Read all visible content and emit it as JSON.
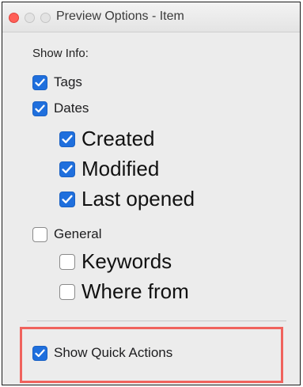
{
  "window": {
    "title": "Preview Options - Item"
  },
  "options": {
    "section_label": "Show Info:",
    "tags": {
      "label": "Tags",
      "checked": true
    },
    "dates": {
      "label": "Dates",
      "checked": true
    },
    "created": {
      "label": "Created",
      "checked": true
    },
    "modified": {
      "label": "Modified",
      "checked": true
    },
    "last_opened": {
      "label": "Last opened",
      "checked": true
    },
    "general": {
      "label": "General",
      "checked": false
    },
    "keywords": {
      "label": "Keywords",
      "checked": false
    },
    "where_from": {
      "label": "Where from",
      "checked": false
    },
    "show_quick_actions": {
      "label": "Show Quick Actions",
      "checked": true
    }
  },
  "colors": {
    "checkbox_accent": "#1f6fdd",
    "highlight_border": "#f0625d",
    "close_button": "#ff5f57"
  },
  "icons": {
    "checked": "checkmark-icon"
  }
}
